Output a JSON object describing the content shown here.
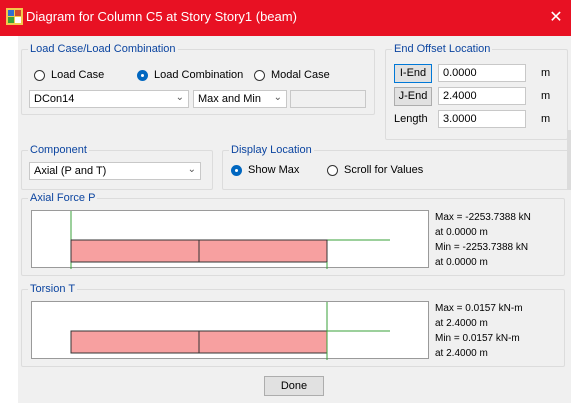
{
  "window": {
    "title": "Diagram for Column C5 at Story Story1 (beam)",
    "close_symbol": "✕",
    "icon": "etabs-app-icon"
  },
  "load_case_group": {
    "legend": "Load Case/Load Combination",
    "radios": [
      {
        "label": "Load Case",
        "checked": false
      },
      {
        "label": "Load Combination",
        "checked": true
      },
      {
        "label": "Modal Case",
        "checked": false
      }
    ],
    "combo_value": "DCon14",
    "envelope_value": "Max and Min",
    "extra_field_value": ""
  },
  "end_offset_group": {
    "legend": "End Offset Location",
    "rows": [
      {
        "button": "I-End",
        "value": "0.0000",
        "unit": "m"
      },
      {
        "button": "J-End",
        "value": "2.4000",
        "unit": "m"
      },
      {
        "label": "Length",
        "value": "3.0000",
        "unit": "m"
      }
    ]
  },
  "component_group": {
    "legend": "Component",
    "value": "Axial (P and T)"
  },
  "display_location_group": {
    "legend": "Display Location",
    "radios": [
      {
        "label": "Show Max",
        "checked": true
      },
      {
        "label": "Scroll for Values",
        "checked": false
      }
    ]
  },
  "axial_group": {
    "legend": "Axial Force P",
    "info": [
      "Max = -2253.7388 kN",
      "at 0.0000 m",
      "Min = -2253.7388 kN",
      "at 0.0000 m"
    ]
  },
  "torsion_group": {
    "legend": "Torsion T",
    "info": [
      "Max = 0.0157 kN-m",
      "at 2.4000 m",
      "Min = 0.0157 kN-m",
      "at 2.4000 m"
    ]
  },
  "footer": {
    "done_label": "Done"
  },
  "colors": {
    "title_bar": "#e81123",
    "diagram_fill": "#f7a0a0",
    "axis_line": "#3aa23a",
    "group_legend": "#0c45a0"
  }
}
